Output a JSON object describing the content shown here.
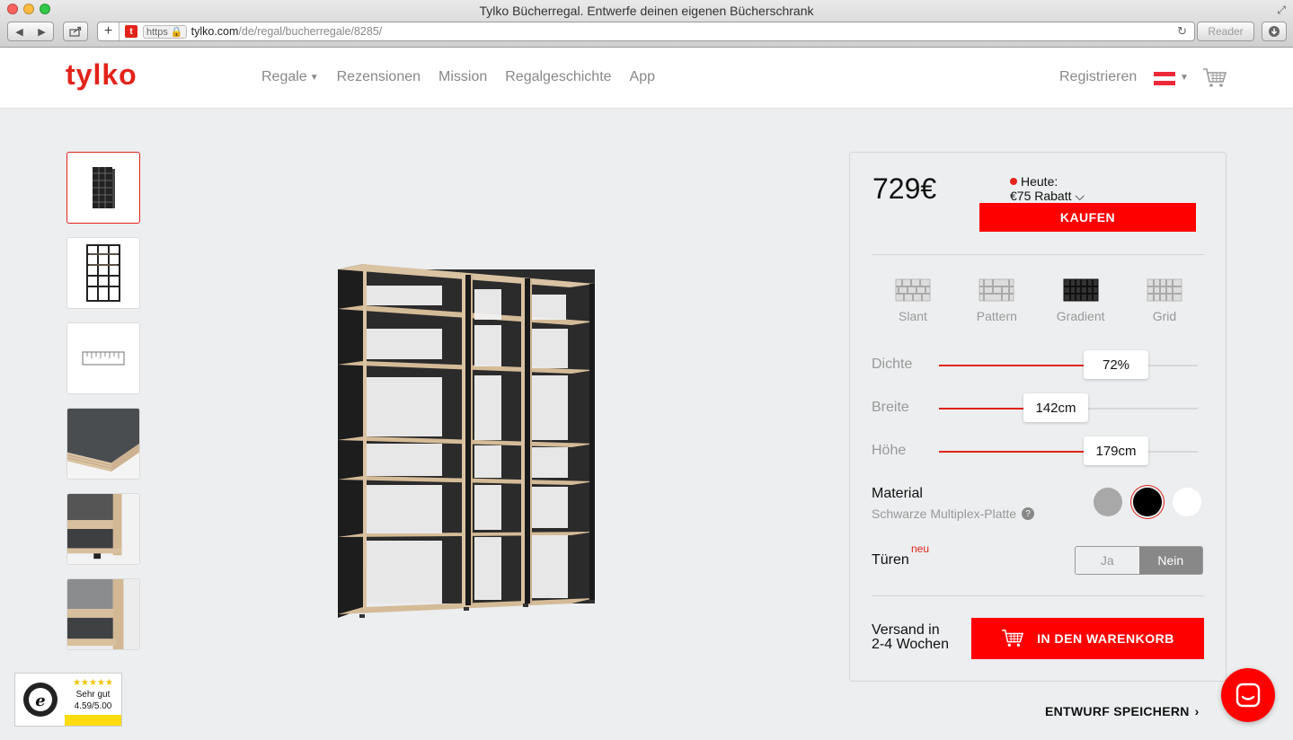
{
  "browser": {
    "title": "Tylko Bücherregal. Entwerfe deinen eigenen Bücherschrank",
    "https_label": "https",
    "url_host": "tylko.com",
    "url_path": "/de/regal/bucherregale/8285/",
    "reader_label": "Reader",
    "favicon_letter": "t"
  },
  "header": {
    "logo": "tylko",
    "nav": [
      "Regale",
      "Rezensionen",
      "Mission",
      "Regalgeschichte",
      "App"
    ],
    "register": "Registrieren"
  },
  "config": {
    "price": "729€",
    "today_label": "Heute:",
    "discount_label": "€75 Rabatt",
    "buy_label": "KAUFEN",
    "styles": [
      "Slant",
      "Pattern",
      "Gradient",
      "Grid"
    ],
    "active_style": "Gradient",
    "sliders": [
      {
        "label": "Dichte",
        "value": "72%",
        "fill_fraction": 0.56
      },
      {
        "label": "Breite",
        "value": "142cm",
        "fill_fraction": 0.32
      },
      {
        "label": "Höhe",
        "value": "179cm",
        "fill_fraction": 0.56
      }
    ],
    "material_title": "Material",
    "material_sub": "Schwarze Multiplex-Platte",
    "help_symbol": "?",
    "swatch_colors": [
      "#a8a8a8",
      "#000000",
      "#ffffff"
    ],
    "selected_swatch": "#000000",
    "doors_label": "Türen",
    "new_badge": "neu",
    "doors_yes": "Ja",
    "doors_no": "Nein",
    "doors_selected": "Nein",
    "shipping_line1": "Versand in",
    "shipping_line2": "2-4 Wochen",
    "cart_label": "IN DEN WARENKORB"
  },
  "save_label": "ENTWURF SPEICHERN",
  "trust": {
    "stars": "★★★★★",
    "rating_label": "Sehr gut",
    "score": "4.59/5.00"
  },
  "colors": {
    "brand_red": "#e2231a",
    "button_red": "#ff0000"
  }
}
